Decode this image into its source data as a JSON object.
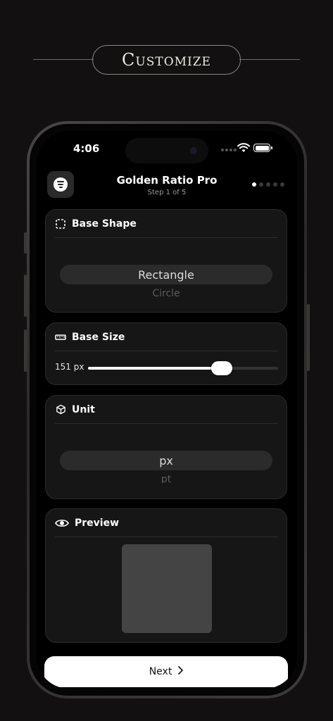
{
  "banner": {
    "title": "Customize"
  },
  "status": {
    "time": "4:06"
  },
  "nav": {
    "title": "Golden Ratio Pro",
    "subtitle": "Step 1 of 5",
    "steps_total": 5,
    "current_step": 1
  },
  "base_shape": {
    "title": "Base Shape",
    "selected": "Rectangle",
    "next_option": "Circle"
  },
  "base_size": {
    "title": "Base Size",
    "value_label": "151 px",
    "slider_fraction": 0.705
  },
  "unit": {
    "title": "Unit",
    "selected": "px",
    "next_option": "pt"
  },
  "preview": {
    "title": "Preview",
    "shape_color": "#444444"
  },
  "footer": {
    "next_label": "Next"
  },
  "colors": {
    "background": "#121010",
    "card": "#161616",
    "accent": "#ffffff"
  }
}
